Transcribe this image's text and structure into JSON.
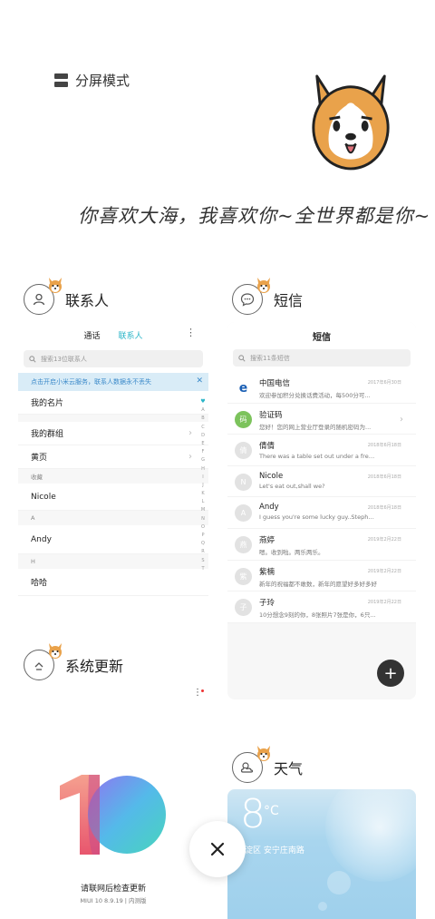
{
  "header": {
    "split_mode_label": "分屏模式",
    "slogan": "你喜欢大海，我喜欢你~全世界都是你~"
  },
  "cards": {
    "contacts": {
      "title": "联系人",
      "tabs": [
        "通话",
        "联系人"
      ],
      "search_placeholder": "搜索13位联系人",
      "notice": "点击开启小米云服务，联系人数据永不丢失",
      "rows": [
        {
          "label": "我的名片"
        },
        {
          "label": "我的群组"
        },
        {
          "label": "黄页"
        }
      ],
      "section_favorites": "收藏",
      "fav": "Nicole",
      "section_a": "A",
      "a_contact": "Andy",
      "section_h": "H",
      "h_contact": "哈哈",
      "alphabet": [
        "A",
        "B",
        "C",
        "D",
        "E",
        "F",
        "G",
        "H",
        "I",
        "J",
        "K",
        "L",
        "M",
        "N",
        "O",
        "P",
        "Q",
        "R",
        "S",
        "T"
      ]
    },
    "sms": {
      "title": "短信",
      "header": "短信",
      "search_placeholder": "搜索11条短信",
      "messages": [
        {
          "name": "中国电信",
          "text": "欢迎参加积分兑换话费活动，每500分可...",
          "date": "2017年6月30日",
          "avatar": "e"
        },
        {
          "name": "验证码",
          "text": "您好！您的网上营业厅登录的随机密码为...",
          "date": "",
          "avatar": "码"
        },
        {
          "name": "倩倩",
          "text": "There was a table set out under a free i...",
          "date": "2018年6月18日",
          "avatar": "倩"
        },
        {
          "name": "Nicole",
          "text": "Let's eat out,shall we?",
          "date": "2018年6月18日",
          "avatar": "N"
        },
        {
          "name": "Andy",
          "text": "I guess you're some lucky guy..Stepha...",
          "date": "2018年6月18日",
          "avatar": "A"
        },
        {
          "name": "燕婷",
          "text": "嗯。收到啦。两乐两乐。",
          "date": "2019年2月22日",
          "avatar": "燕"
        },
        {
          "name": "紫楠",
          "text": "新年的祝福都不敢数，新年的愿望好多好多好",
          "date": "2019年2月22日",
          "avatar": "紫"
        },
        {
          "name": "子玲",
          "text": "10分想念9刻的你，8张照片7张是你，6只...",
          "date": "2019年2月22日",
          "avatar": "子"
        }
      ],
      "fab": "+"
    },
    "update": {
      "title": "系统更新",
      "cta": "请联网后检查更新",
      "version": "MIUI 10 8.9.19 | 内测版"
    },
    "weather": {
      "title": "天气",
      "temp": "8",
      "unit": "°C",
      "location": "海淀区 安宁庄南路"
    }
  },
  "close_label": "×",
  "colors": {
    "accent": "#2bb5c8",
    "notice_bg": "#d9ecf7",
    "fab": "#333333"
  }
}
